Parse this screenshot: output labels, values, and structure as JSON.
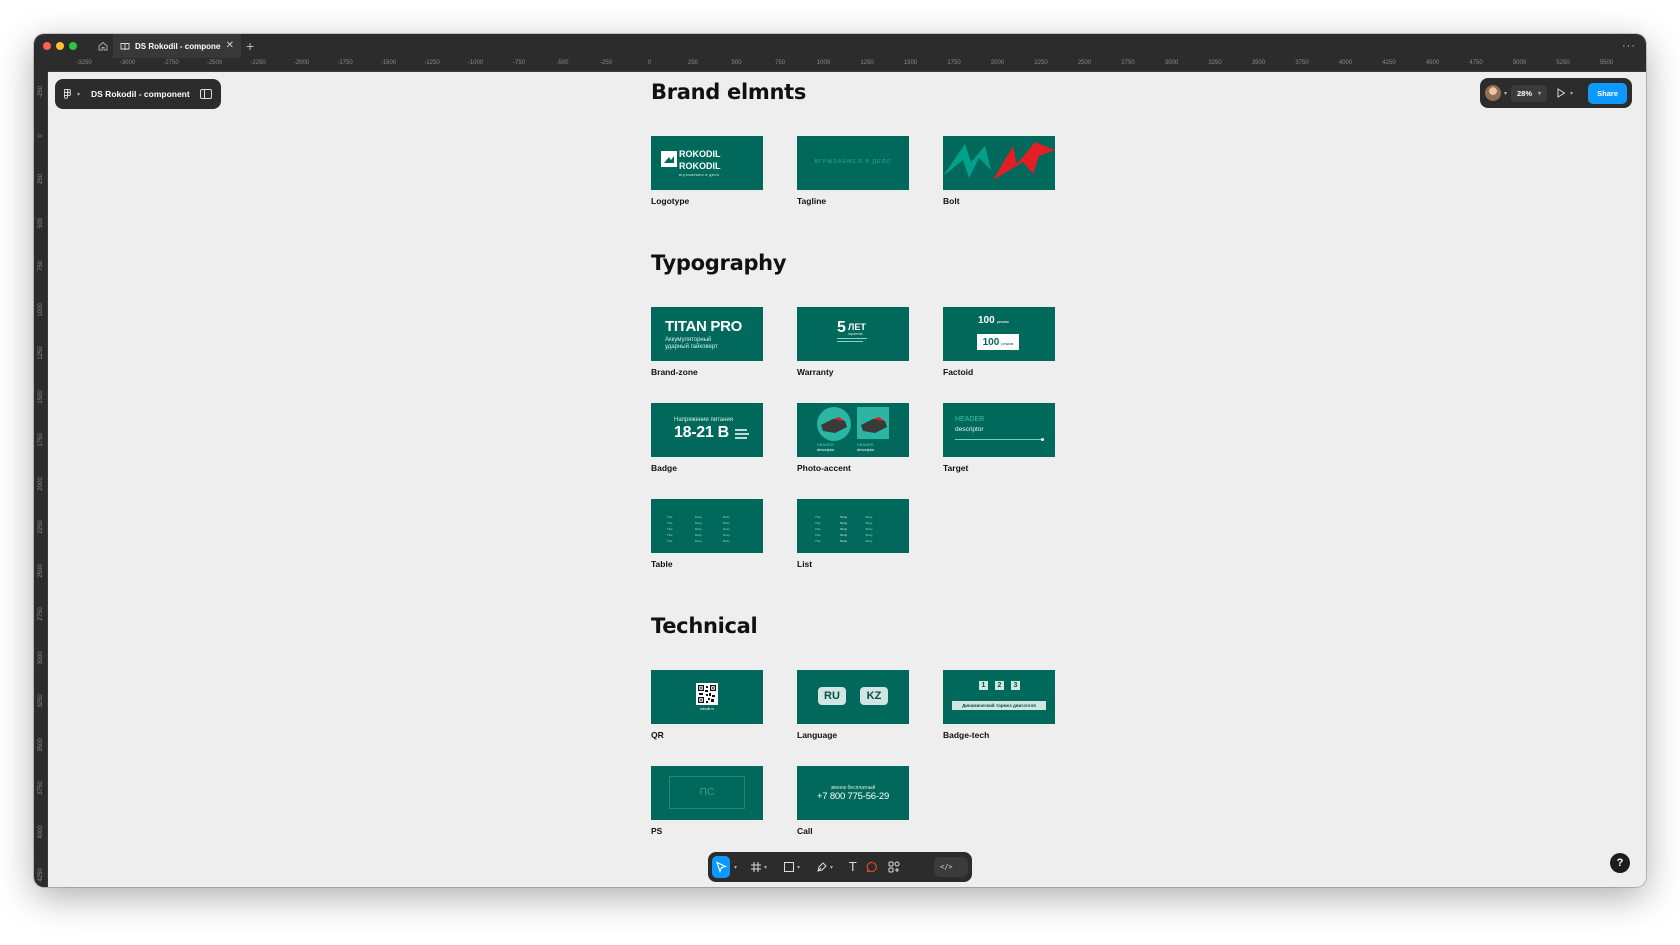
{
  "window": {
    "tab_title": "DS Rokodil - component",
    "add_tab_glyph": "+",
    "close_glyph": "✕",
    "more_glyph": "···"
  },
  "colors": {
    "card_bg": "#00695c",
    "accent": "#0d99ff",
    "canvas": "#eeeeee",
    "chrome": "#2c2c2c",
    "bolt_red": "#e31e24",
    "bolt_green": "#00a08a"
  },
  "rulers": {
    "horizontal": [
      "-3250",
      "-3000",
      "-2750",
      "-2500",
      "-2250",
      "-2000",
      "-1750",
      "-1500",
      "-1250",
      "-1000",
      "-750",
      "-500",
      "-250",
      "0",
      "250",
      "500",
      "750",
      "1000",
      "1250",
      "1500",
      "1750",
      "2000",
      "2250",
      "2500",
      "2750",
      "3000",
      "3250",
      "3500",
      "3750",
      "4000",
      "4250",
      "4500",
      "4750",
      "5000",
      "5250",
      "5500"
    ],
    "vertical": [
      "-250",
      "0",
      "250",
      "500",
      "750",
      "1000",
      "1250",
      "1500",
      "1750",
      "2000",
      "2250",
      "2500",
      "2750",
      "3000",
      "3250",
      "3500",
      "3750",
      "4000",
      "4250"
    ]
  },
  "file_panel": {
    "name": "DS Rokodil - component"
  },
  "top_right": {
    "zoom": "28%",
    "share_label": "Share"
  },
  "sections": {
    "brand": {
      "title": "Brand elmnts",
      "cards": [
        {
          "label": "Logotype",
          "logo_line_1": "ROKODIL",
          "logo_line_2": "ROKODIL",
          "logo_sub": "вгрызаемся в дело"
        },
        {
          "label": "Tagline",
          "text": "вгрызаемся в дело"
        },
        {
          "label": "Bolt"
        }
      ]
    },
    "typography": {
      "title": "Typography",
      "cards": [
        {
          "label": "Brand-zone",
          "heading": "TITAN PRO",
          "sub1": "Аккумуляторный",
          "sub2": "ударный гайковерт"
        },
        {
          "label": "Warranty",
          "number": "5",
          "word": "ЛЕТ",
          "small": "гарантии"
        },
        {
          "label": "Factoid",
          "number": "100",
          "unit": "режим"
        },
        {
          "label": "Badge",
          "caption": "Напряжение питания",
          "value": "18-21 В"
        },
        {
          "label": "Photo-accent",
          "header": "HEADER",
          "desc": "descriptor"
        },
        {
          "label": "Target",
          "header": "HEADER",
          "desc": "descriptor"
        },
        {
          "label": "Table",
          "cell_title": "Title",
          "cell_body": "Body"
        },
        {
          "label": "List",
          "cell_title": "Title",
          "cell_body": "Body"
        }
      ]
    },
    "technical": {
      "title": "Technical",
      "cards": [
        {
          "label": "QR",
          "url": "rokodil.ru"
        },
        {
          "label": "Language",
          "lang1": "RU",
          "lang2": "KZ"
        },
        {
          "label": "Badge-tech",
          "n1": "1",
          "n2": "2",
          "n3": "3",
          "caption": "Динамический тормоз двигателя"
        },
        {
          "label": "PS",
          "text": "ПС"
        },
        {
          "label": "Call",
          "caption": "звонок бесплатный",
          "phone": "+7 800 775-56-29"
        }
      ]
    }
  },
  "toolbar": {
    "tools": [
      "move-tool-icon",
      "frame-tool-icon",
      "rectangle-tool-icon",
      "pen-tool-icon",
      "text-tool-icon",
      "comment-tool-icon",
      "components-icon"
    ],
    "text_tool_glyph": "T",
    "dev_mode_glyph": "</>"
  },
  "help": {
    "label": "?"
  }
}
